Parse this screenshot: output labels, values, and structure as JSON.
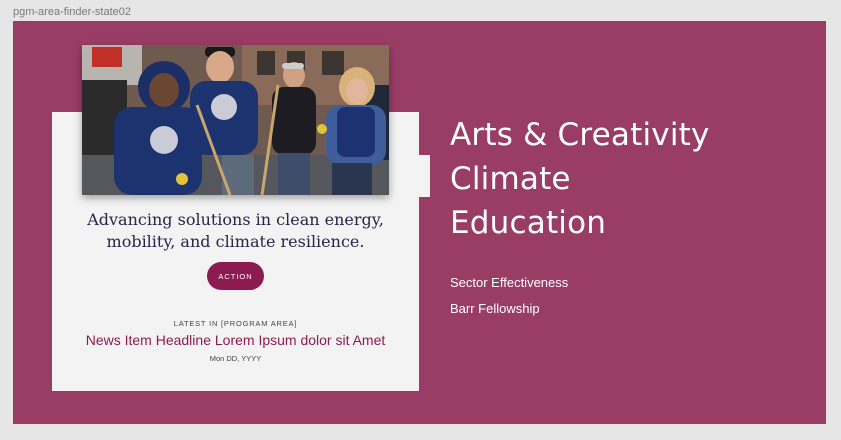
{
  "frame_label": "pgm-area-finder-state02",
  "colors": {
    "panel": "#993d66",
    "card": "#f3f3f3",
    "accent": "#8c1c50",
    "blurb_text": "#2a2448"
  },
  "card": {
    "photo_alt": "Volunteers in matching sweatshirts holding brooms and rakes",
    "blurb": "Advancing solutions in clean energy, mobility, and climate resilience.",
    "action_label": "ACTION",
    "latest_label": "LATEST IN [PROGRAM AREA]",
    "headline": "News Item Headline Lorem Ipsum dolor sit Amet",
    "date": "Mon DD, YYYY"
  },
  "program_areas": [
    {
      "label": "Arts & Creativity"
    },
    {
      "label": "Climate"
    },
    {
      "label": "Education"
    }
  ],
  "secondary_links": [
    {
      "label": "Sector Effectiveness"
    },
    {
      "label": "Barr Fellowship"
    }
  ]
}
